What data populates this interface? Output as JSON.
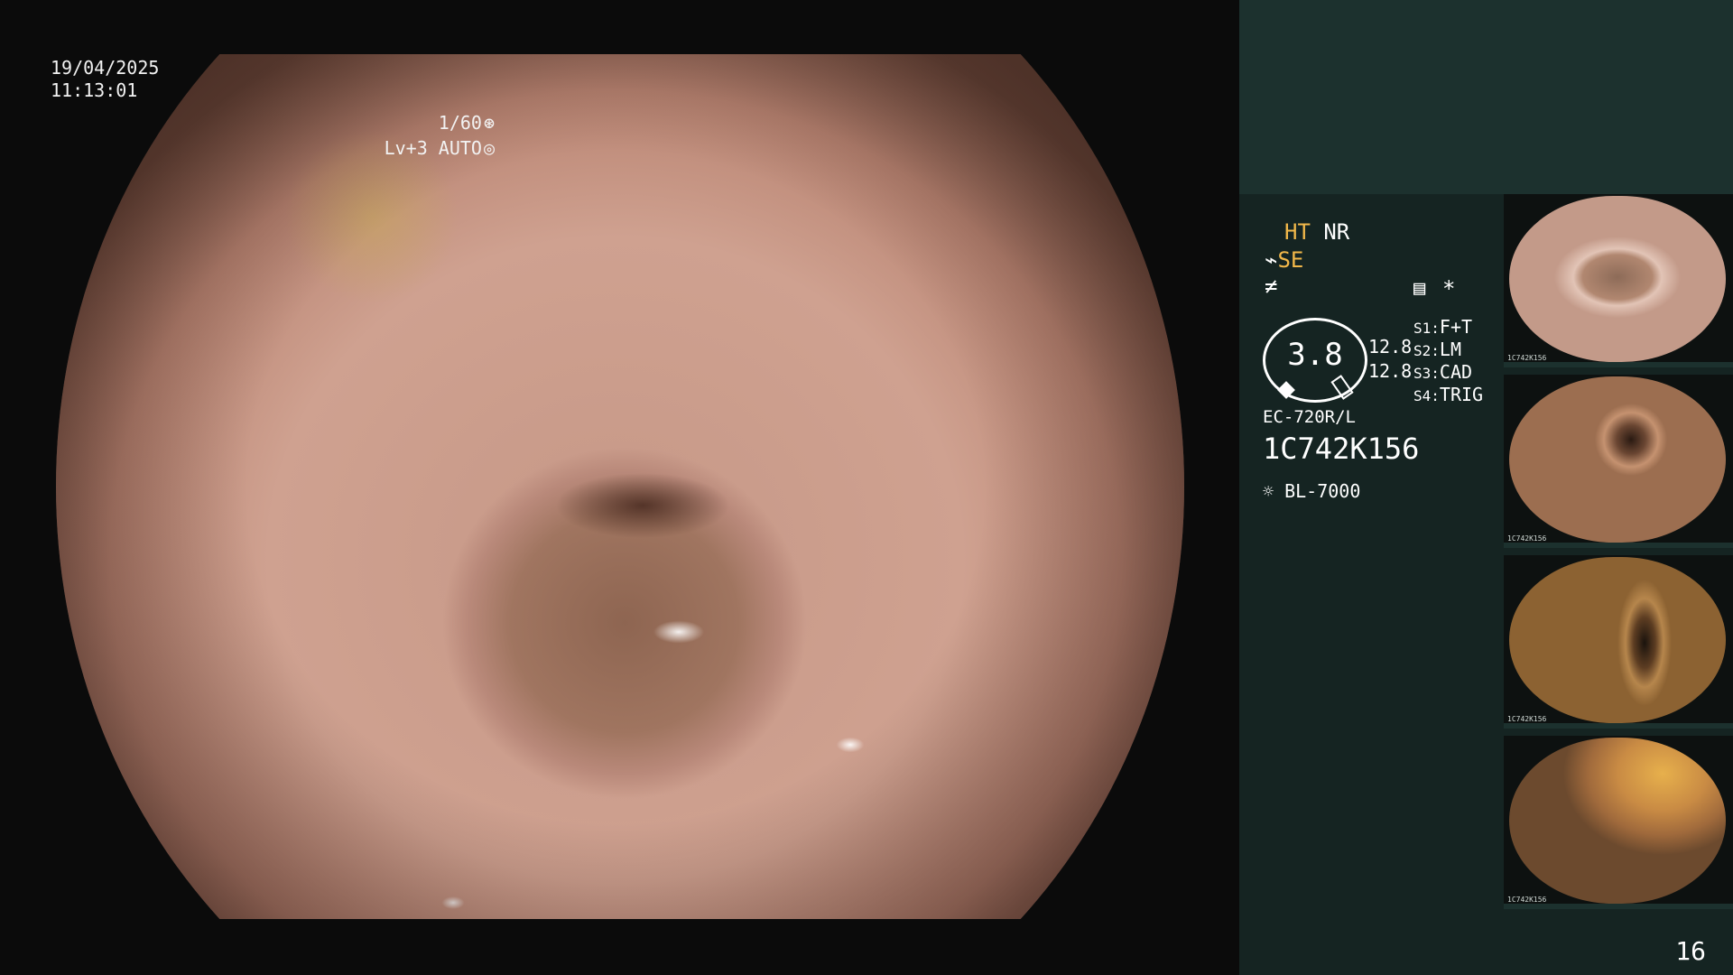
{
  "overlay": {
    "date": "19/04/2025",
    "time": "11:13:01",
    "shutter": "1/60",
    "shutter_icon": "aperture-icon",
    "level": "Lv+3 AUTO",
    "level_icon": "iris-icon"
  },
  "panel": {
    "mode_ht": "HT",
    "mode_nr": "NR",
    "mode_se": "SE",
    "se_icon": "squiggle-icon",
    "fn_icon": "not-equal-icon",
    "menu_icon": "list-icon",
    "asterisk": "*",
    "ring_value": "3.8",
    "left_values": [
      "12.8",
      "12.8"
    ],
    "switches": [
      {
        "label": "S1:",
        "value": "F+T"
      },
      {
        "label": "S2:",
        "value": "LM"
      },
      {
        "label": "S3:",
        "value": "CAD"
      },
      {
        "label": "S4:",
        "value": "TRIG"
      }
    ],
    "scope_model": "EC-720R/L",
    "serial": "1C742K156",
    "light_source": "BL-7000",
    "light_icon": "sun-icon",
    "page_number": "16"
  },
  "thumbnails": [
    {
      "caption": "1C742K156"
    },
    {
      "caption": "1C742K156"
    },
    {
      "caption": "1C742K156"
    },
    {
      "caption": "1C742K156"
    }
  ],
  "colors": {
    "panel_bg": "#152422",
    "panel_header": "#1c312e",
    "accent_yellow": "#f2b84a"
  }
}
